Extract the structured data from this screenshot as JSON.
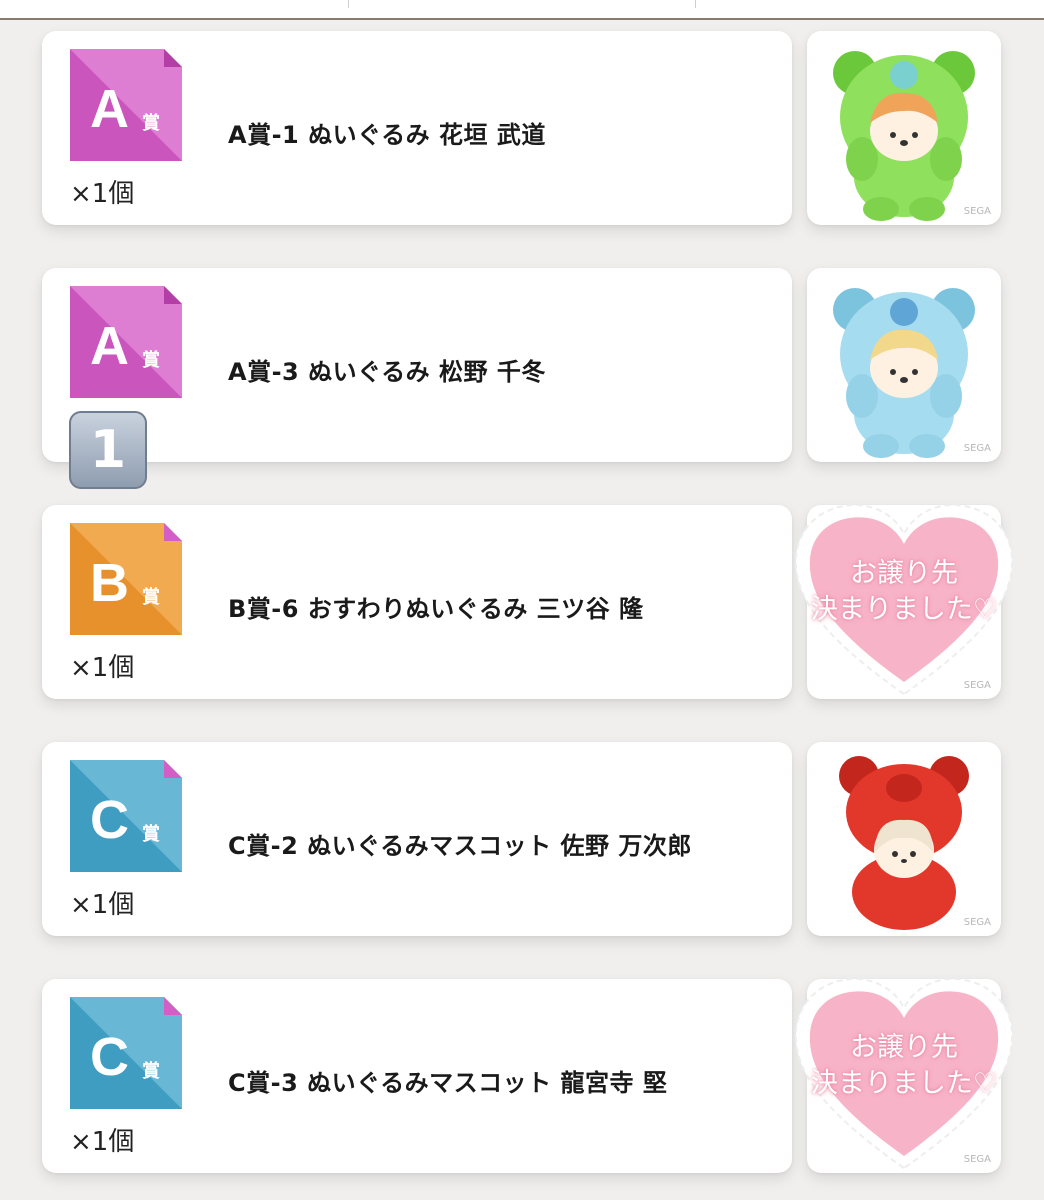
{
  "prizes": [
    {
      "grade": "A",
      "suffix": "賞",
      "title": "A賞-1 ぬいぐるみ 花垣 武道",
      "qty": "×1個",
      "color": "#d35fc6",
      "light": "#e28fda",
      "plush_color": "#8fe05c",
      "plush_dark": "#6cc83b"
    },
    {
      "grade": "A",
      "suffix": "賞",
      "title": "A賞-3 ぬいぐるみ 松野 千冬",
      "qty_key": "1",
      "color": "#d35fc6",
      "light": "#e28fda",
      "plush_color": "#a6dcef",
      "plush_dark": "#7cc4de"
    },
    {
      "grade": "B",
      "suffix": "賞",
      "title": "B賞-6 おすわりぬいぐるみ 三ツ谷 隆",
      "qty": "×1個",
      "color": "#ee9a36",
      "light": "#f4b661",
      "overlay_line1": "お譲り先",
      "overlay_line2": "決まりました♡"
    },
    {
      "grade": "C",
      "suffix": "賞",
      "title": "C賞-2 ぬいぐるみマスコット 佐野 万次郎",
      "qty": "×1個",
      "color": "#47a6c9",
      "light": "#7fc4dd",
      "plush_color": "#e2382c",
      "plush_dark": "#c2261c"
    },
    {
      "grade": "C",
      "suffix": "賞",
      "title": "C賞-3 ぬいぐるみマスコット 龍宮寺 堅",
      "qty": "×1個",
      "color": "#47a6c9",
      "light": "#7fc4dd",
      "overlay_line1": "お譲り先",
      "overlay_line2": "決まりました♡"
    }
  ]
}
